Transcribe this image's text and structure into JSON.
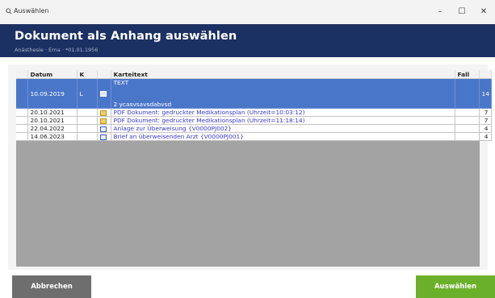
{
  "window": {
    "title": "Auswählen",
    "icon": "search-icon",
    "controls": {
      "minimize": "–",
      "maximize": "☐",
      "close": "✕"
    }
  },
  "header": {
    "title": "Dokument als Anhang auswählen",
    "subtitle": "Anästhesie · Erna ·  *01.01.1956"
  },
  "table": {
    "columns": [
      "Datum",
      "K",
      "",
      "Karteitext",
      "Fall",
      ""
    ],
    "rows": [
      {
        "datum": "10.09.2019",
        "k": "L",
        "icon": "document-icon",
        "text_line1": "TEXT",
        "text_line2": "2 ycasvsavsdabvsd",
        "fall": "",
        "num": "14",
        "selected": true
      },
      {
        "datum": "20.10.2021",
        "k": "",
        "icon": "pdf-icon",
        "text": "PDF Dokument: gedruckter Medikationsplan (Uhrzeit=10:03:12)",
        "fall": "",
        "num": "7"
      },
      {
        "datum": "20.10.2021",
        "k": "",
        "icon": "pdf-icon",
        "text": "PDF Dokument: gedruckter Medikationsplan (Uhrzeit=11:18:14)",
        "fall": "",
        "num": "7"
      },
      {
        "datum": "22.04.2022",
        "k": "",
        "icon": "word-doc-icon",
        "text": "Anlage zur Überweisung {V0000PJ002}",
        "fall": "",
        "num": "4"
      },
      {
        "datum": "14.06.2023",
        "k": "",
        "icon": "word-doc-icon",
        "text": "Brief an überweisenden Arzt {V0000PJ001}",
        "fall": "",
        "num": "4"
      }
    ]
  },
  "buttons": {
    "cancel": "Abbrechen",
    "select": "Auswählen"
  },
  "colors": {
    "header_bg": "#1c3163",
    "selected_row": "#4a76c9",
    "grid_empty": "#a3a3a3",
    "select_button": "#6bb02a",
    "cancel_button": "#6e6e6e",
    "link_text": "#3a3ac8"
  }
}
